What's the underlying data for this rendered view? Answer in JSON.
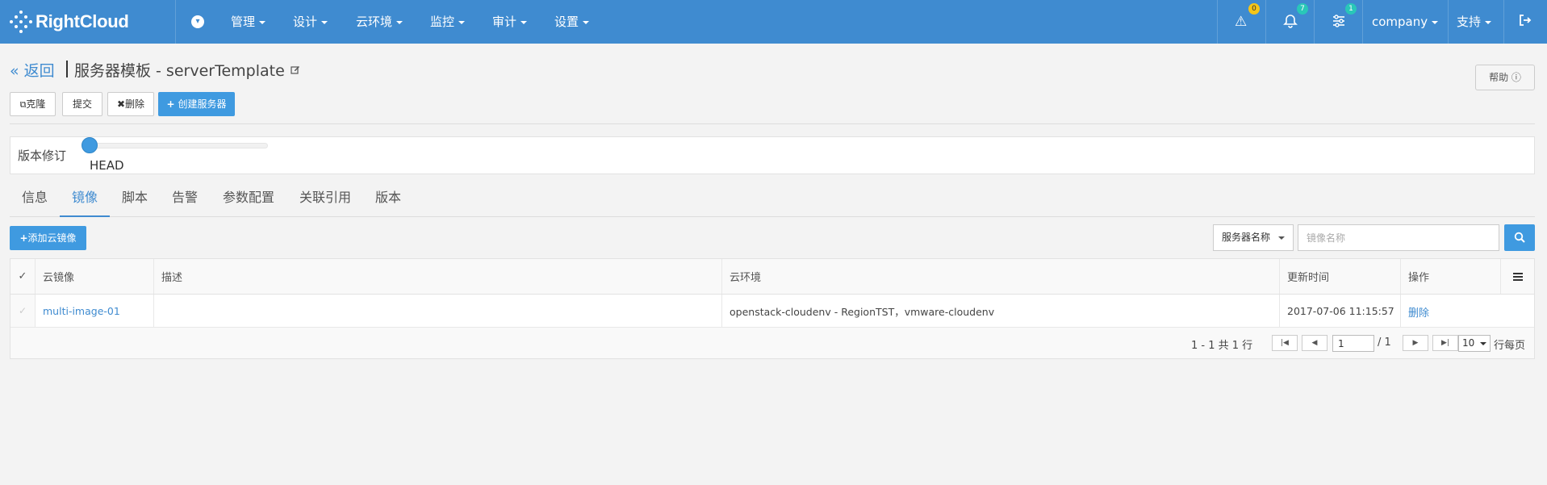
{
  "brand": {
    "name": "RightCloud"
  },
  "nav": {
    "items": [
      {
        "label": "管理"
      },
      {
        "label": "设计"
      },
      {
        "label": "云环境"
      },
      {
        "label": "监控"
      },
      {
        "label": "审计"
      },
      {
        "label": "设置"
      }
    ],
    "alerts": {
      "warning_count": "0",
      "bell_count": "7",
      "settings_count": "1"
    },
    "company": "company",
    "support": "支持"
  },
  "header": {
    "back": "« 返回",
    "title": "服务器模板 - serverTemplate",
    "help": "帮助 ⓘ"
  },
  "actions": {
    "clone": "克隆",
    "submit": "提交",
    "delete": "删除",
    "create_server": "创建服务器"
  },
  "version": {
    "label": "版本修订",
    "current": "HEAD"
  },
  "tabs": [
    {
      "label": "信息",
      "active": false
    },
    {
      "label": "镜像",
      "active": true
    },
    {
      "label": "脚本",
      "active": false
    },
    {
      "label": "告警",
      "active": false
    },
    {
      "label": "参数配置",
      "active": false
    },
    {
      "label": "关联引用",
      "active": false
    },
    {
      "label": "版本",
      "active": false
    }
  ],
  "toolbar": {
    "add_image": "添加云镜像",
    "filter_value": "服务器名称",
    "search_placeholder": "镜像名称"
  },
  "table": {
    "columns": [
      "云镜像",
      "描述",
      "云环境",
      "更新时间",
      "操作"
    ],
    "rows": [
      {
        "image": "multi-image-01",
        "description": "",
        "cloud_env": "openstack-cloudenv - RegionTST，vmware-cloudenv",
        "updated": "2017-07-06 11:15:57",
        "action": "删除"
      }
    ]
  },
  "pagination": {
    "summary": "1 - 1 共 1 行",
    "page": "1",
    "total": "/ 1",
    "page_size": "10",
    "per_page": "行每页"
  },
  "colors": {
    "primary": "#3f8bd0",
    "button": "#3f9ae0",
    "badge_yellow": "#f5c518",
    "badge_teal": "#29c7b8"
  }
}
